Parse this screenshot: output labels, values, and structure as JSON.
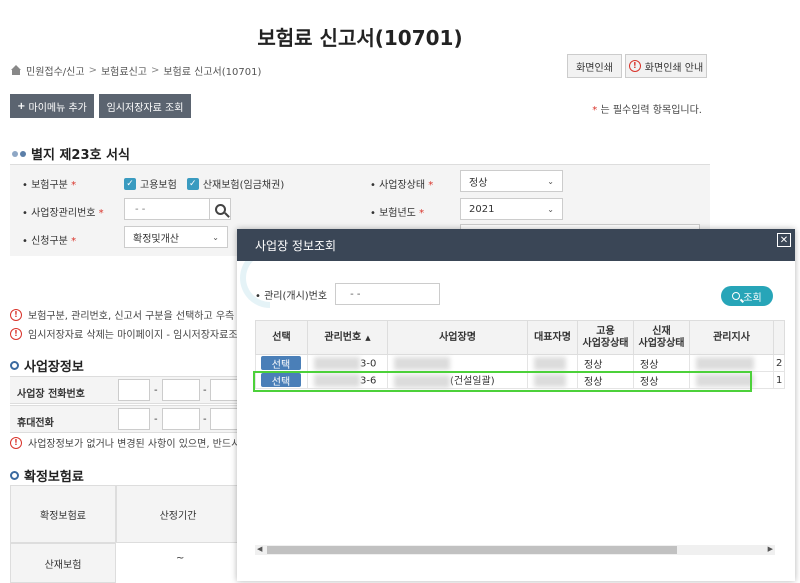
{
  "page": {
    "title": "보험료 신고서(10701)",
    "breadcrumb": [
      "민원접수/신고",
      "보험료신고",
      "보험료 신고서(10701)"
    ],
    "print_button": "화면인쇄",
    "print_guide_button": "화면인쇄 안내",
    "my_menu_button": "마이메뉴 추가",
    "temp_data_button": "임시저장자료 조회",
    "required_note_star": "*",
    "required_note": "는 필수입력 항목입니다."
  },
  "form": {
    "section_title": "별지 제23호 서식",
    "insurance_type_label": "보험구분",
    "insurance_opt1": "고용보험",
    "insurance_opt2": "산재보험(임금채권)",
    "business_status_label": "사업장상태",
    "business_status_value": "정상",
    "mgmt_no_label": "사업장관리번호",
    "mgmt_no_value": "-   -",
    "year_label": "보험년도",
    "year_value": "2021",
    "report_type_label": "신청구분",
    "report_type_value": "확정및개산",
    "star": "*"
  },
  "notes": {
    "warn1": "보험구분, 관리번호, 신고서 구분을 선택하고 우측 조",
    "warn2": "임시저장자료 삭제는 마이페이지 - 임시저장자료조"
  },
  "business_info": {
    "title": "사업장정보",
    "phone_label": "사업장 전화번호",
    "mobile_label": "휴대전화",
    "warn": "사업장정보가 없거나 변경된 사항이 있으면, 반드시",
    "dash": "-"
  },
  "premium": {
    "title": "확정보험료",
    "col1": "확정보험료",
    "col2": "산정기간",
    "row_label": "산재보험",
    "tilde": "~"
  },
  "modal": {
    "title": "사업장 정보조회",
    "close": "✕",
    "search_label": "관리(개시)번호",
    "search_value": "-   -",
    "search_button": "조회",
    "columns": [
      "선택",
      "관리번호",
      "사업장명",
      "대표자명",
      "고용\n사업장상태",
      "신재\n사업장상태",
      "관리지사"
    ],
    "rows": [
      {
        "pick": "선택",
        "mgmt_suffix": "3-0",
        "name_prefix": "",
        "name_suffix": "",
        "emp_status": "정상",
        "ind_status": "정상",
        "tail": "2"
      },
      {
        "pick": "선택",
        "mgmt_suffix": "3-6",
        "name_prefix": "",
        "name_suffix": "(건설일괄)",
        "emp_status": "정상",
        "ind_status": "정상",
        "tail": "1"
      }
    ]
  },
  "colors": {
    "modal_header": "#3a4656",
    "accent": "#27a5b8",
    "pick_button": "#4a7fb8",
    "highlight": "#4cd13a"
  }
}
